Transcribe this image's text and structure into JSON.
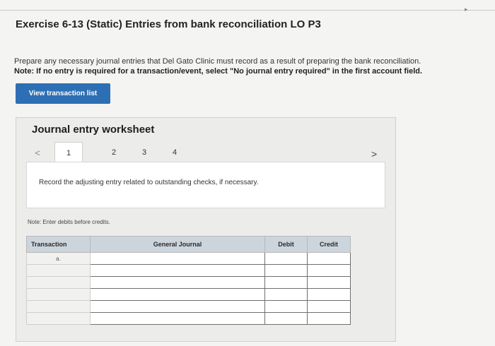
{
  "header": {
    "title": "Exercise 6-13 (Static) Entries from bank reconciliation LO P3"
  },
  "instructions": {
    "text": "Prepare any necessary journal entries that Del Gato Clinic must record as a result of preparing the bank reconciliation.",
    "note": "Note: If no entry is required for a transaction/event, select \"No journal entry required\" in the first account field."
  },
  "view_button": {
    "label": "View transaction list"
  },
  "worksheet": {
    "title": "Journal entry worksheet",
    "prev_arrow": "<",
    "next_arrow": ">",
    "tabs": [
      "1",
      "2",
      "3",
      "4"
    ],
    "prompt": "Record the adjusting entry related to outstanding checks, if necessary.",
    "note": "Note: Enter debits before credits.",
    "table": {
      "headers": {
        "transaction": "Transaction",
        "general_journal": "General Journal",
        "debit": "Debit",
        "credit": "Credit"
      },
      "first_transaction": "a."
    }
  }
}
